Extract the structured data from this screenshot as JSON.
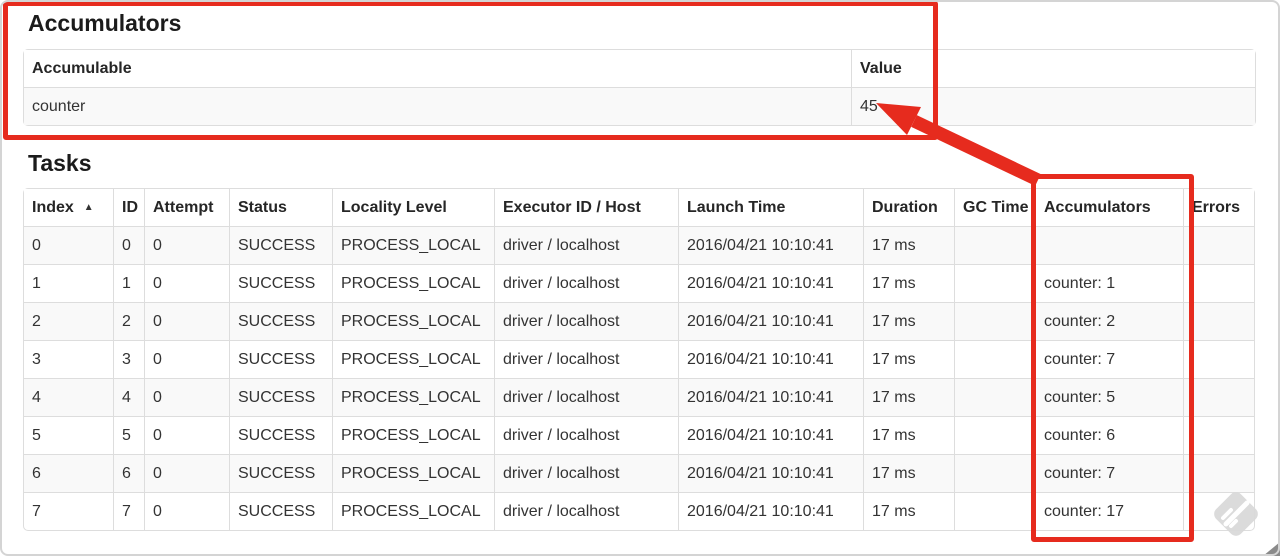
{
  "accumulators_section": {
    "title": "Accumulators",
    "table": {
      "headers": [
        "Accumulable",
        "Value"
      ],
      "rows": [
        [
          "counter",
          "45"
        ]
      ]
    }
  },
  "tasks_section": {
    "title": "Tasks",
    "sort_icon": "▲",
    "table": {
      "headers": [
        "Index",
        "ID",
        "Attempt",
        "Status",
        "Locality Level",
        "Executor ID / Host",
        "Launch Time",
        "Duration",
        "GC Time",
        "Accumulators",
        "Errors"
      ],
      "rows": [
        [
          "0",
          "0",
          "0",
          "SUCCESS",
          "PROCESS_LOCAL",
          "driver / localhost",
          "2016/04/21 10:10:41",
          "17 ms",
          "",
          "",
          ""
        ],
        [
          "1",
          "1",
          "0",
          "SUCCESS",
          "PROCESS_LOCAL",
          "driver / localhost",
          "2016/04/21 10:10:41",
          "17 ms",
          "",
          "counter: 1",
          ""
        ],
        [
          "2",
          "2",
          "0",
          "SUCCESS",
          "PROCESS_LOCAL",
          "driver / localhost",
          "2016/04/21 10:10:41",
          "17 ms",
          "",
          "counter: 2",
          ""
        ],
        [
          "3",
          "3",
          "0",
          "SUCCESS",
          "PROCESS_LOCAL",
          "driver / localhost",
          "2016/04/21 10:10:41",
          "17 ms",
          "",
          "counter: 7",
          ""
        ],
        [
          "4",
          "4",
          "0",
          "SUCCESS",
          "PROCESS_LOCAL",
          "driver / localhost",
          "2016/04/21 10:10:41",
          "17 ms",
          "",
          "counter: 5",
          ""
        ],
        [
          "5",
          "5",
          "0",
          "SUCCESS",
          "PROCESS_LOCAL",
          "driver / localhost",
          "2016/04/21 10:10:41",
          "17 ms",
          "",
          "counter: 6",
          ""
        ],
        [
          "6",
          "6",
          "0",
          "SUCCESS",
          "PROCESS_LOCAL",
          "driver / localhost",
          "2016/04/21 10:10:41",
          "17 ms",
          "",
          "counter: 7",
          ""
        ],
        [
          "7",
          "7",
          "0",
          "SUCCESS",
          "PROCESS_LOCAL",
          "driver / localhost",
          "2016/04/21 10:10:41",
          "17 ms",
          "",
          "counter: 17",
          ""
        ]
      ]
    }
  },
  "annotations": {
    "highlight_color": "#e62b1e"
  }
}
